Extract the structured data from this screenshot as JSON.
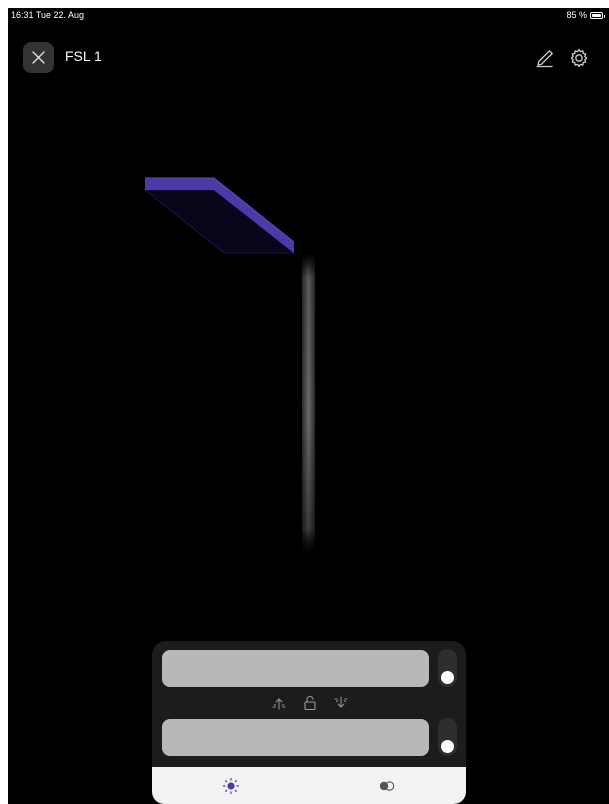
{
  "status_bar": {
    "time": "16:31  Tue 22. Aug",
    "battery_text": "85 %",
    "battery_level": 0.85
  },
  "header": {
    "title": "FSL 1"
  },
  "icons": {
    "close": "close-icon",
    "edit": "pencil-icon",
    "settings": "gear-icon",
    "uplight": "uplight-icon",
    "lock": "lock-icon",
    "downlight": "downlight-icon",
    "brightness_tab": "sun-icon",
    "color_tab": "toggle-circles-icon"
  },
  "colors": {
    "background": "#000000",
    "lamp_head": "#4b3aa8",
    "accent": "#4b3aa8",
    "panel": "#1c1c1e",
    "slider": "#b8b8b8",
    "tabbar": "#f2f2f2"
  },
  "controls": {
    "slider_1": {
      "name": "upper light level"
    },
    "slider_2": {
      "name": "lower light level"
    },
    "toggle_1": {
      "state": "off"
    },
    "toggle_2": {
      "state": "off"
    }
  },
  "tabs": {
    "active": "brightness"
  }
}
